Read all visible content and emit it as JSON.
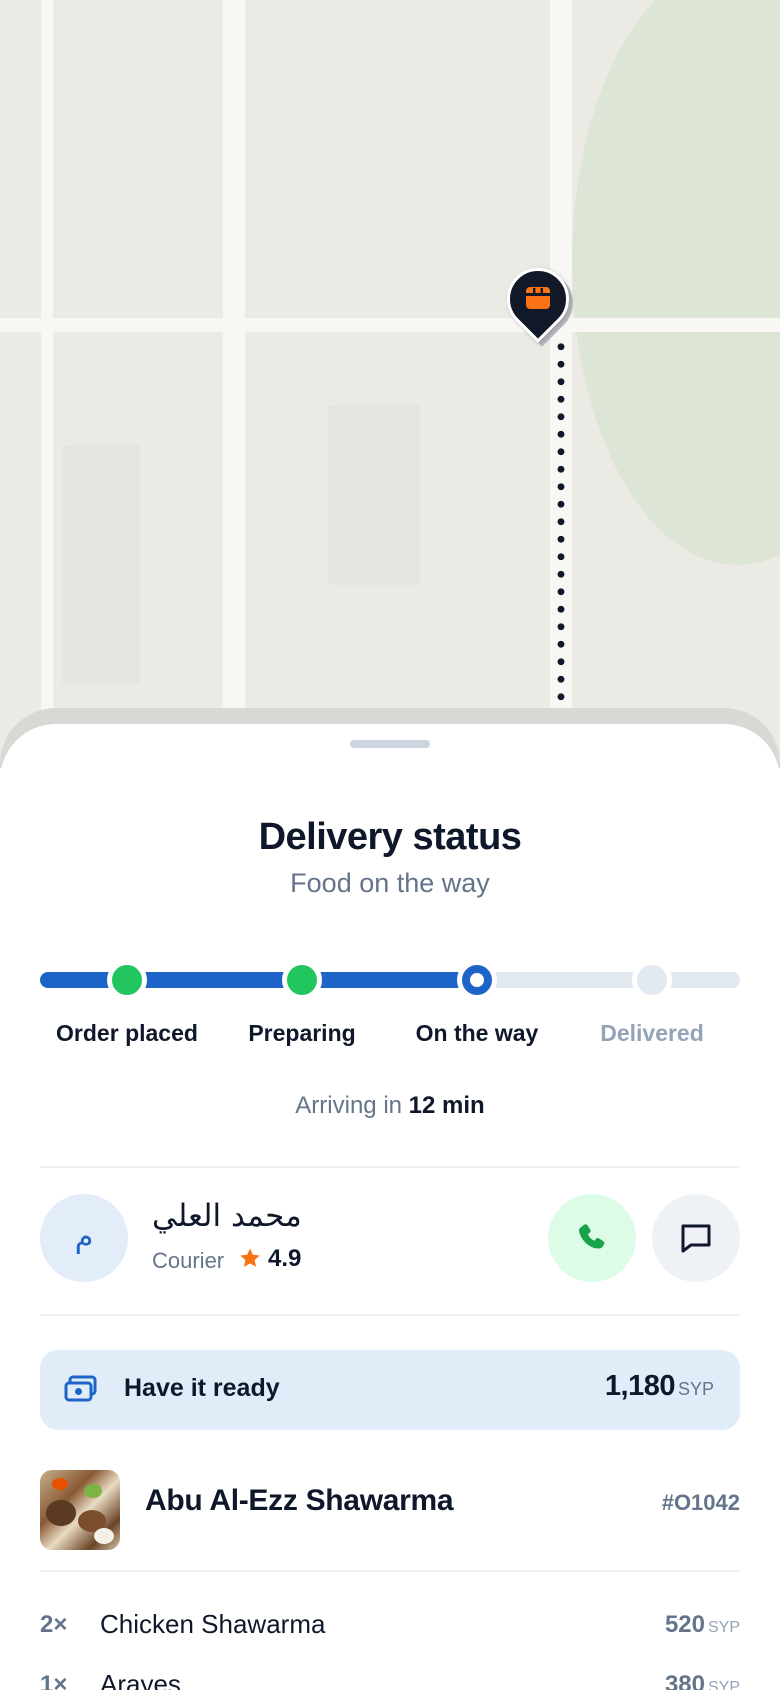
{
  "sheet": {
    "title": "Delivery status",
    "subtitle": "Food on the way"
  },
  "progress": {
    "steps": [
      {
        "label": "Order placed",
        "state": "done"
      },
      {
        "label": "Preparing",
        "state": "done"
      },
      {
        "label": "On the way",
        "state": "current"
      },
      {
        "label": "Delivered",
        "state": "pending"
      }
    ],
    "colors": {
      "active": "#1d64c8",
      "done": "#22c55e",
      "pending": "#e2e8f0"
    }
  },
  "eta": {
    "prefix": "Arriving in",
    "value": "12 min"
  },
  "courier": {
    "initial": "م",
    "name": "محمد العلي",
    "role": "Courier",
    "rating": "4.9",
    "call_icon": "phone-icon",
    "chat_icon": "chat-bubble-icon"
  },
  "payment": {
    "icon": "cash-icon",
    "label": "Have it ready",
    "amount": "1,180",
    "currency": "SYP"
  },
  "order": {
    "restaurant": "Abu Al-Ezz Shawarma",
    "number": "#O1042",
    "items": [
      {
        "qty": "2×",
        "name": "Chicken Shawarma",
        "price": "520",
        "currency": "SYP"
      },
      {
        "qty": "1×",
        "name": "Arayes",
        "price": "380",
        "currency": "SYP"
      }
    ]
  },
  "map": {
    "pin_icon": "store-icon",
    "pin_color": "#f97316"
  }
}
